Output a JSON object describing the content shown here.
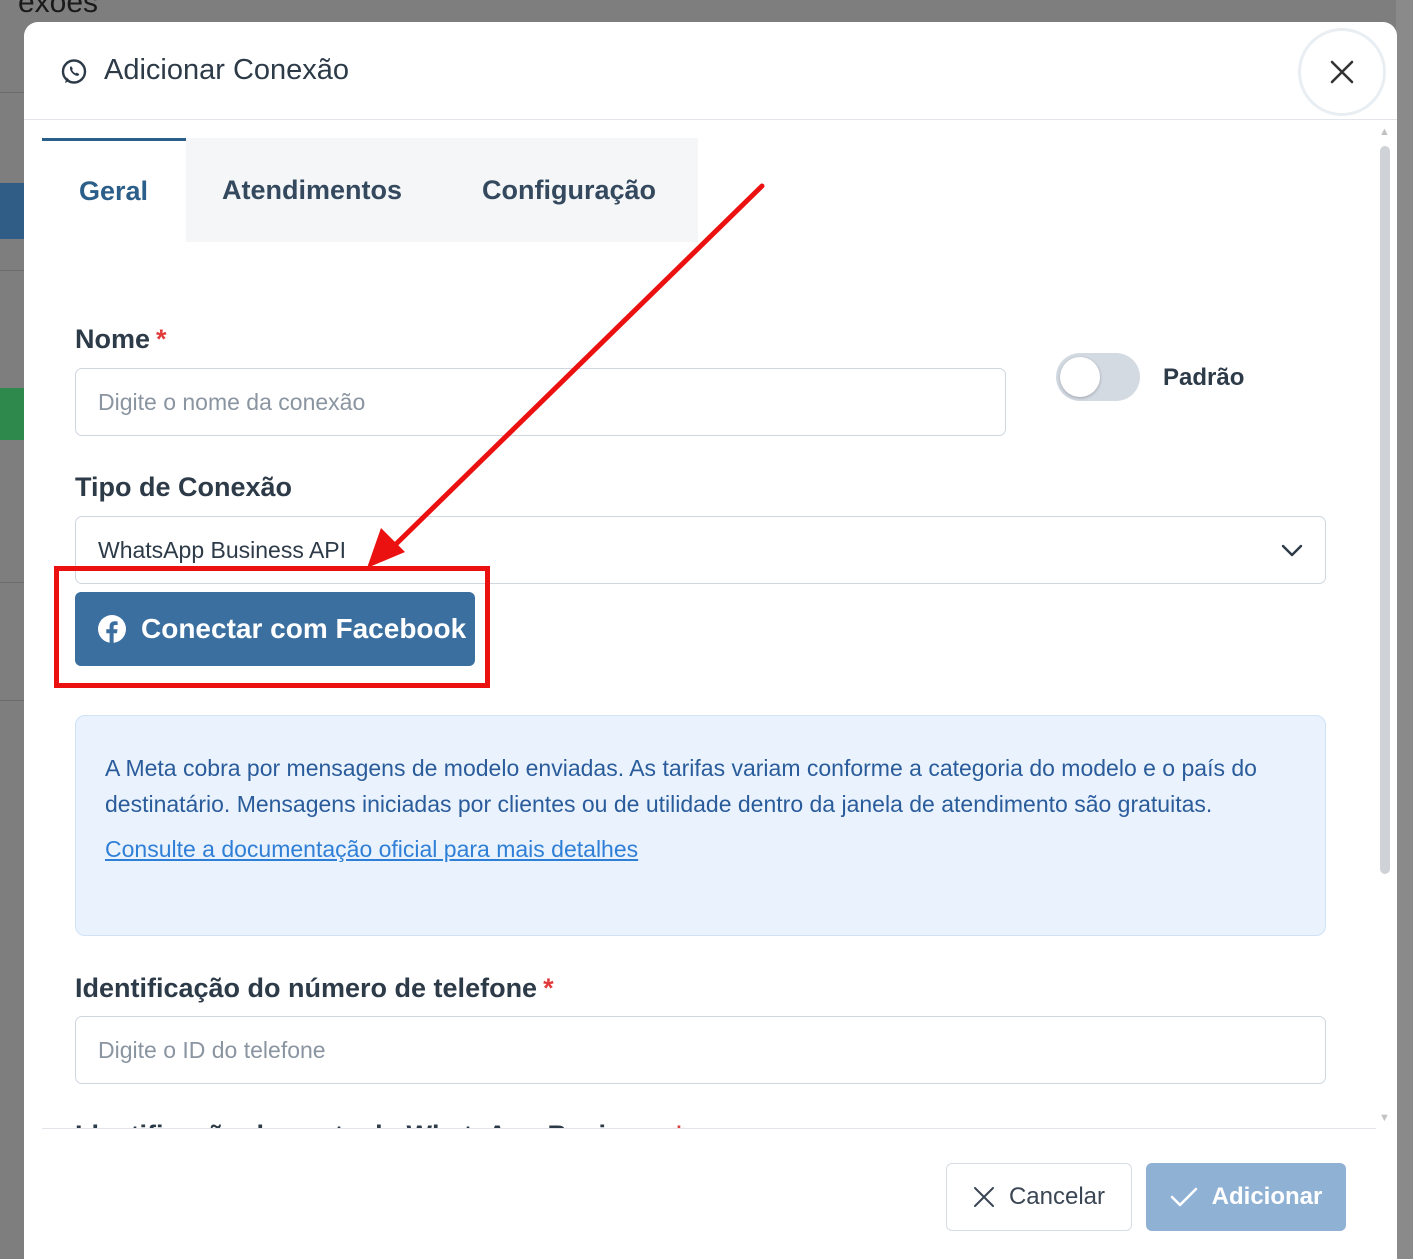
{
  "background": {
    "title_fragment": "exões"
  },
  "modal": {
    "title": "Adicionar Conexão",
    "title_icon": "whatsapp-icon",
    "close_icon": "close-icon"
  },
  "tabs": [
    {
      "label": "Geral",
      "active": true
    },
    {
      "label": "Atendimentos",
      "active": false
    },
    {
      "label": "Configuração",
      "active": false
    }
  ],
  "form": {
    "name_label": "Nome",
    "required_marker": "*",
    "name_placeholder": "Digite o nome da conexão",
    "default_toggle_label": "Padrão",
    "default_toggle_on": false,
    "type_label": "Tipo de Conexão",
    "type_value": "WhatsApp Business API",
    "facebook_button": "Conectar com Facebook",
    "info_text": "A Meta cobra por mensagens de modelo enviadas. As tarifas variam conforme a categoria do modelo e o país do destinatário. Mensagens iniciadas por clientes ou de utilidade dentro da janela de atendimento são gratuitas.",
    "info_link": "Consulte a documentação oficial para mais detalhes",
    "phone_id_label": "Identificação do número de telefone",
    "phone_id_placeholder": "Digite o ID do telefone",
    "waba_id_label": "Identificação da conta do WhatsApp Business"
  },
  "footer": {
    "cancel_label": "Cancelar",
    "add_label": "Adicionar"
  },
  "colors": {
    "primary": "#3b6fa0",
    "annotation": "#ec1111",
    "info_bg": "#eaf3fd",
    "required": "#e23b3b"
  }
}
